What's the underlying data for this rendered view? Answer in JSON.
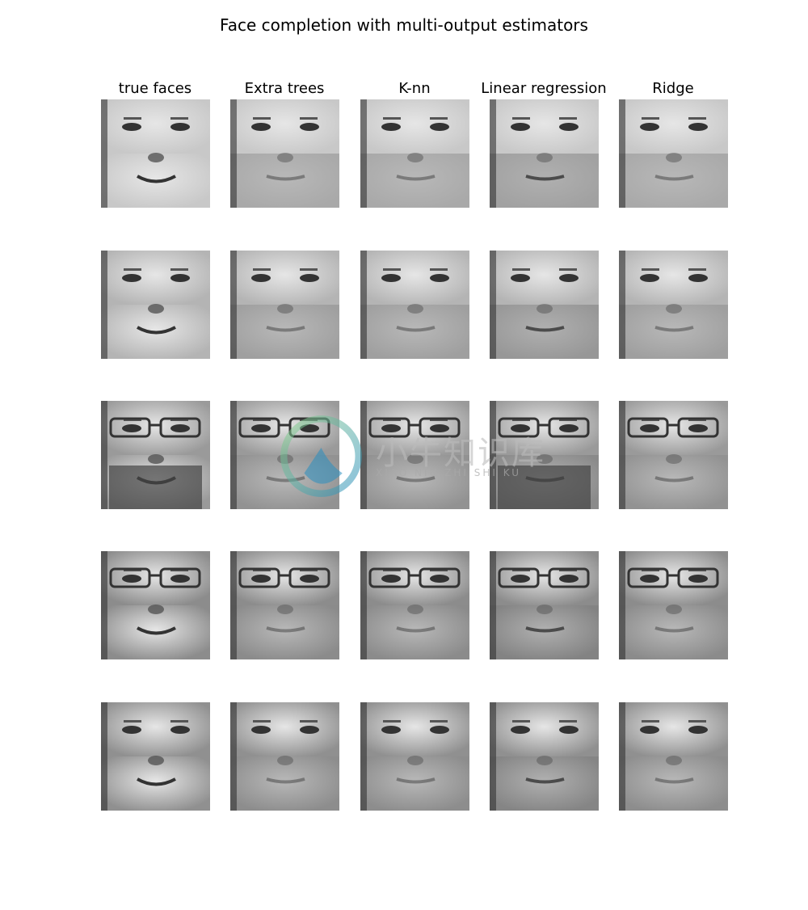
{
  "title": "Face completion with multi-output estimators",
  "columns": [
    "true faces",
    "Extra trees",
    "K-nn",
    "Linear regression",
    "Ridge"
  ],
  "rows": 5,
  "colormap": "gray",
  "watermark": {
    "logo_text": "小牛知识库",
    "logo_subtext": "XIAO NIU ZHI SHI KU"
  }
}
